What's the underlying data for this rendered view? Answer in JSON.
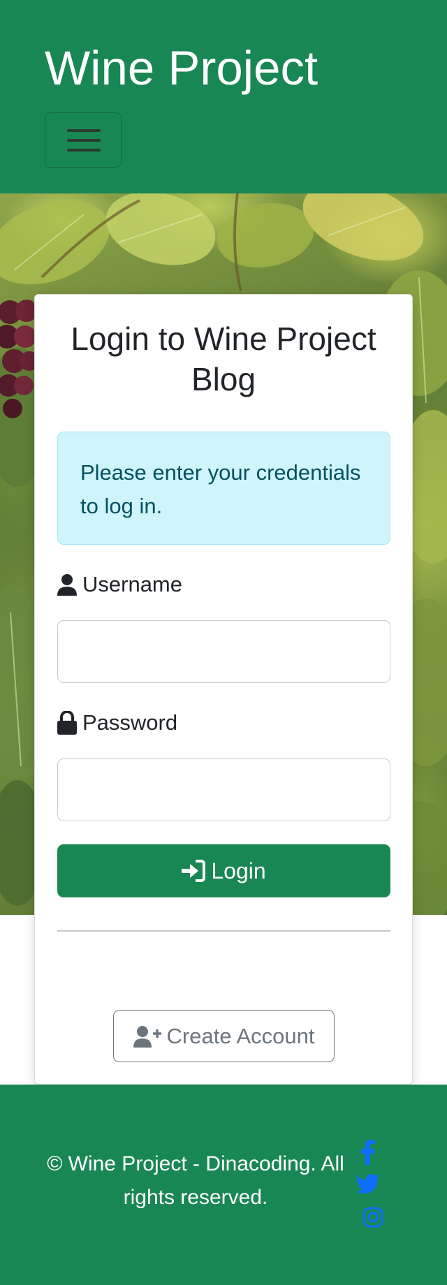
{
  "header": {
    "brand": "Wine Project",
    "menu_icon": "hamburger-menu-icon"
  },
  "login": {
    "title": "Login to Wine Project Blog",
    "alert": "Please enter your credentials to log in.",
    "username_label": "Username",
    "username_icon": "user-icon",
    "username_value": "",
    "password_label": "Password",
    "password_icon": "lock-icon",
    "password_value": "",
    "login_button": "Login",
    "login_icon": "sign-in-icon",
    "create_account_button": "Create Account",
    "create_account_icon": "user-plus-icon"
  },
  "footer": {
    "copyright": "© Wine Project - Dinacoding. All rights reserved.",
    "social": [
      "facebook-icon",
      "twitter-icon",
      "instagram-icon"
    ],
    "social_color": "#0d6efd"
  },
  "colors": {
    "primary_green": "#198754",
    "alert_bg": "#cff4fc",
    "alert_text": "#055160",
    "secondary": "#6c757d"
  }
}
